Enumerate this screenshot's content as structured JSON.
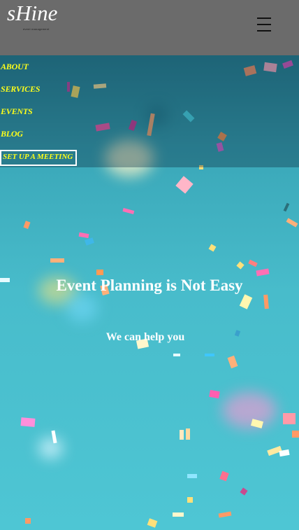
{
  "header": {
    "logo": "sHine",
    "tagline": "event management",
    "menu_icon": "hamburger-menu-icon",
    "background_color": "#6b6b6b"
  },
  "nav": {
    "items": [
      {
        "label": "ABOUT"
      },
      {
        "label": "SERVICES"
      },
      {
        "label": "EVENTS"
      },
      {
        "label": "BLOG"
      }
    ],
    "cta_label": "SET UP A MEETING",
    "link_color": "#ffff1a"
  },
  "hero": {
    "title": "Event Planning is Not Easy",
    "subtitle": "We can help you",
    "background_image": "confetti on teal background"
  }
}
